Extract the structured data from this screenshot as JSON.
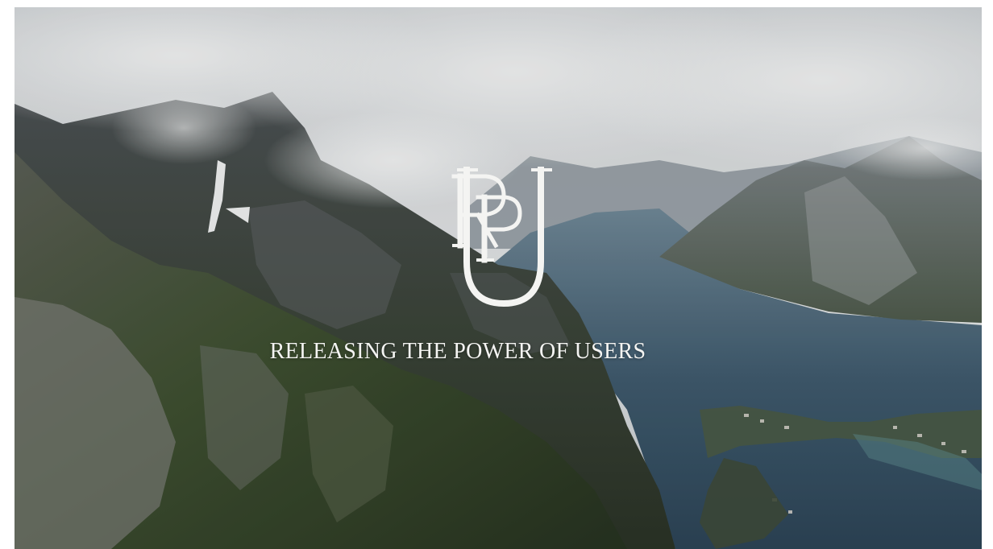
{
  "hero": {
    "logo_monogram": "RPU",
    "tagline": "RELEASING THE POWER OF USERS",
    "background_image": "mountain-fjord-landscape"
  },
  "colors": {
    "text": "#f4f4f2",
    "sky": "#d9dcde",
    "water": "#3e5a70",
    "mountain_dark": "#2f3a33",
    "mountain_green": "#4b5f3c"
  }
}
